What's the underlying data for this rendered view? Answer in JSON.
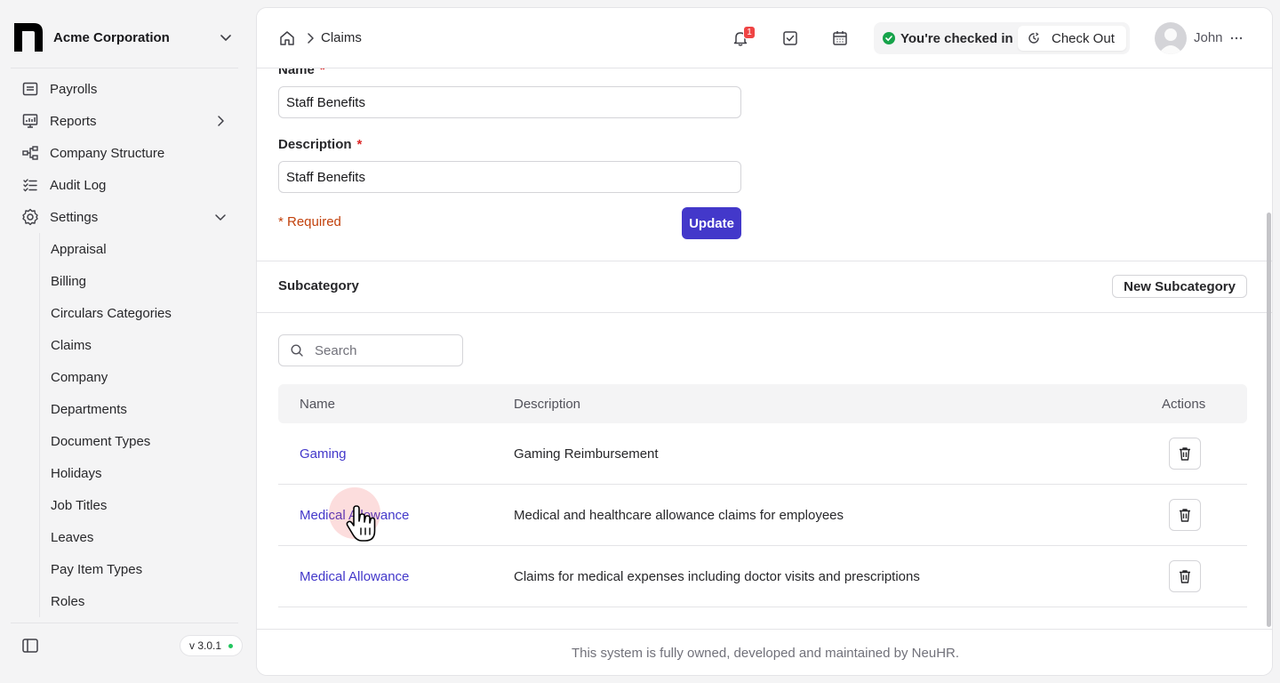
{
  "sidebar": {
    "org_name": "Acme Corporation",
    "nav": [
      {
        "label": "Payrolls",
        "icon": "receipt-icon"
      },
      {
        "label": "Reports",
        "icon": "chart-icon"
      },
      {
        "label": "Company Structure",
        "icon": "hierarchy-icon"
      },
      {
        "label": "Audit Log",
        "icon": "list-check-icon"
      },
      {
        "label": "Settings",
        "icon": "gear-icon"
      }
    ],
    "settings_items": [
      "Appraisal",
      "Billing",
      "Circulars Categories",
      "Claims",
      "Company",
      "Departments",
      "Document Types",
      "Holidays",
      "Job Titles",
      "Leaves",
      "Pay Item Types",
      "Roles"
    ],
    "version": "v 3.0.1"
  },
  "header": {
    "breadcrumb": "Claims",
    "notification_count": "1",
    "checkin_status": "You're checked in",
    "checkout_label": "Check Out",
    "user_name": "John"
  },
  "form": {
    "name_label": "Name",
    "name_value": "Staff Benefits",
    "description_label": "Description",
    "description_value": "Staff Benefits",
    "required_marker": "*",
    "required_note": "* Required",
    "update_label": "Update"
  },
  "subcategory": {
    "title": "Subcategory",
    "new_label": "New Subcategory",
    "search_placeholder": "Search",
    "columns": [
      "Name",
      "Description",
      "Actions"
    ],
    "rows": [
      {
        "name": "Gaming",
        "description": "Gaming Reimbursement"
      },
      {
        "name": "Medical Allowance",
        "description": "Medical and healthcare allowance claims for employees"
      },
      {
        "name": "Medical Allowance",
        "description": "Claims for medical expenses including doctor visits and prescriptions"
      }
    ]
  },
  "footer": {
    "text": "This system is fully owned, developed and maintained by NeuHR."
  },
  "colors": {
    "primary": "#4338ca",
    "danger": "#ef4444",
    "success": "#16a34a"
  }
}
